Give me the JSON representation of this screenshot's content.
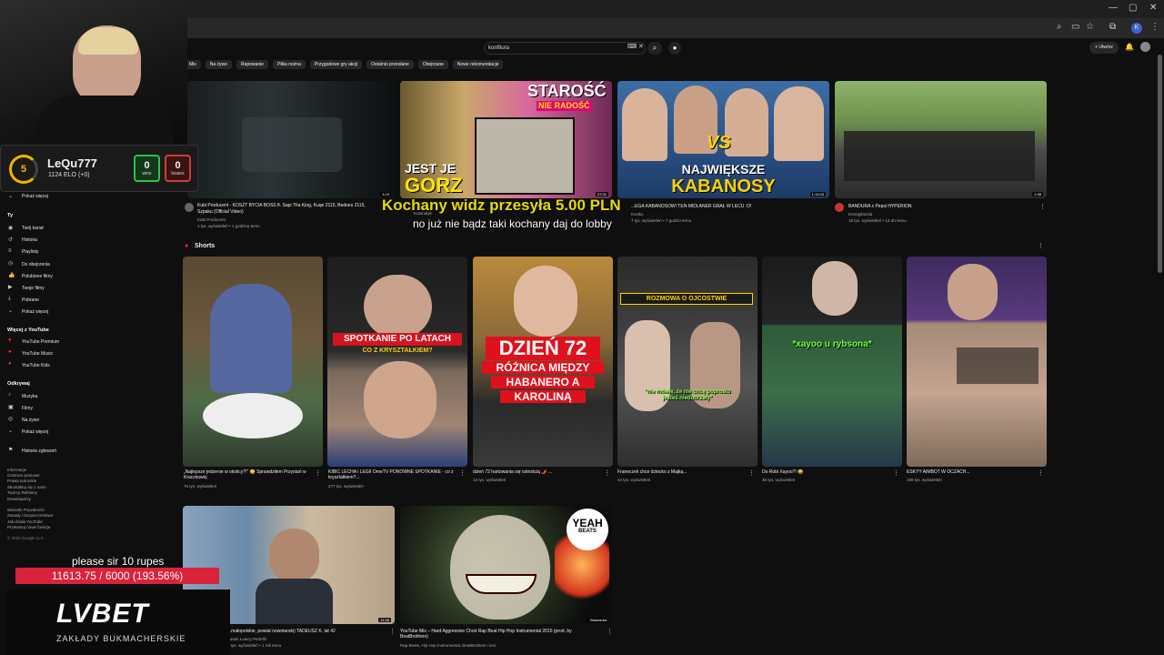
{
  "browser": {
    "window_controls": [
      "—",
      "▢",
      "✕"
    ],
    "profile_letter": "K"
  },
  "masthead": {
    "search_value": "konfitura",
    "create_label": "+ Utwórz"
  },
  "chips": [
    "Mix",
    "Na żywo",
    "Rapowanie",
    "Piłka nożna",
    "Przygodowe gry akcji",
    "Ostatnio przesłane",
    "Obejrzane",
    "Nowe rekomendacje"
  ],
  "sidebar": {
    "show_more_top": "Pokaż więcej",
    "you_heading": "Ty",
    "you_items": [
      "Twój kanał",
      "Historia",
      "Playlisty",
      "Do obejrzenia",
      "Polubione filmy",
      "Twoje filmy",
      "Pobrane",
      "Pokaż więcej"
    ],
    "more_heading": "Więcej z YouTube",
    "more_items": [
      "YouTube Premium",
      "YouTube Music",
      "YouTube Kids"
    ],
    "explore_heading": "Odkrywaj",
    "explore_items": [
      "Muzyka",
      "Filmy",
      "Na żywo",
      "Pokaż więcej"
    ],
    "report_history": "Historia zgłoszeń",
    "footer": [
      "Informacje",
      "Centrum prasowe",
      "Prawa autorskie",
      "Skontaktuj się z nami",
      "Twórcy  Reklamy",
      "Deweloperzy",
      "Warunki  Prywatność",
      "Zasady i bezpieczeństwo",
      "Jak działa YouTube",
      "Przetestuj nowe funkcje"
    ],
    "copyright": "© 2025 Google LLC"
  },
  "videos_row1": [
    {
      "title": "Kubi Producent - KOSZT BYCIA BOSS ft. Sapi Tha King, Kuqe 2115, Bedoes 2115, Szpaku (Official Video)",
      "channel": "Kubi Producent",
      "meta": "1 tys. wyświetleń • 1 godzinę temu",
      "duration": "3:15"
    },
    {
      "title": "",
      "channel": "Krasnalyk",
      "meta": "1 tys. wyświetleń",
      "duration": "37:01"
    },
    {
      "title": "...EGA KABANOSÓW! TEN MIDLANER GRAŁ W LECU :O!",
      "channel": "Kosiku",
      "meta": "7 tys. wyświetleń • 7 godzin temu",
      "duration": "1:10:03"
    },
    {
      "title": "BANDURA x Pepsi HYPERION",
      "channel": "Energylandia",
      "meta": "18 tys. wyświetleń • 13 dni temu",
      "duration": "1:38"
    }
  ],
  "thumb_text": {
    "t2_top": "STAROŚĆ",
    "t2_sub": "NIE RADOŚĆ",
    "t2_bottom1": "JEST JE",
    "t2_bottom2": "GORZ",
    "t3_vs": "VS",
    "t3_line1": "NAJWIĘKSZE",
    "t3_line2": "KABANOSY"
  },
  "shorts": {
    "heading": "Shorts",
    "items": [
      {
        "title": "„Najlepsze jedzenie w okolicy?!” 😋 Sprawdziłem Przystań w Kraczkowej",
        "meta": "75 tys. wyświetleń"
      },
      {
        "title": "KIBIC LECHA i LEGII OmeTV PONOWNE SPOTKANIE - co z kryształkiem?...",
        "meta": "277 tys. wyświetleń"
      },
      {
        "title": "dzień 72 hartowania się ostrością 🌶️ ...",
        "meta": "13 tys. wyświetleń"
      },
      {
        "title": "Franeczek chce dziecko z Majką...",
        "meta": "44 tys. wyświetleń"
      },
      {
        "title": "Do Robi Xayoo?! 😂",
        "meta": "36 tys. wyświetleń"
      },
      {
        "title": "ESKYY AIMBOT W OCZACH...",
        "meta": "199 tys. wyświetleń"
      }
    ],
    "s2_banner": "SPOTKANIE PO LATACH",
    "s2_sub": "CO Z KRYSZTAŁKIEM?",
    "s3_day": "DZIEŃ 72",
    "s3_l1": "RÓŻNICA MIĘDZY",
    "s3_l2": "HABANERO A",
    "s3_l3": "KAROLINĄ",
    "s4_banner": "ROZMOWA O OJCOSTWIE",
    "s4_caption": "\"nie mówię, że nie chcę poprostu jesteś niedobrzały\"",
    "s5_caption": "*xayoo u rybsona*"
  },
  "videos_row3": [
    {
      "title": "...małopolskie, powiat nowotarski) TADEUSZ K. lat 42",
      "channel": "Kanał: Łowcy Pedofili",
      "meta": "1 tys. wyświetleń • 1 rok temu",
      "duration": "11:36"
    },
    {
      "title": "YouTube Mix – Hard Aggressive Choir Rap Beat Hip Hop Instrumental 2015 (prod. by BeatBrothers)",
      "channel": "Rap Beats, Hip Hop Instrumental, BeatBrothers i inni",
      "meta": "",
      "duration": "Składanka",
      "badge1": "YEAH",
      "badge2": "BEATS"
    }
  ],
  "stream": {
    "level": "5",
    "nickname": "LeQu777",
    "elo": "1124 ELO (+0)",
    "wins": "0",
    "wins_label": "wins",
    "losses": "0",
    "losses_label": "losses",
    "donation_top": "Kochany widz przesyła 5.00 PLN",
    "donation_msg": "no już nie bądz taki kochany daj do lobby",
    "goal_text": "please sir 10 rupes",
    "goal_value": "11613.75 / 6000 (193.56%)",
    "goal_progress": 1.0,
    "sponsor": "LVBET",
    "sponsor_sub": "ZAKŁADY BUKMACHERSKIE"
  }
}
